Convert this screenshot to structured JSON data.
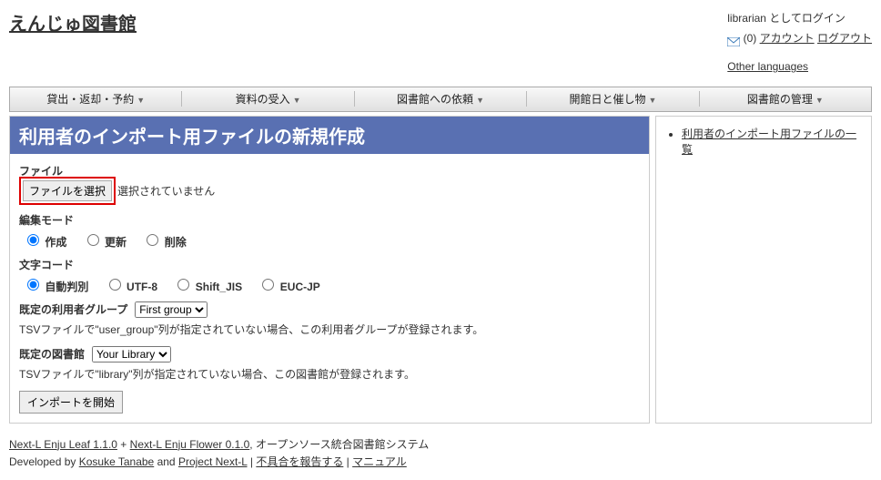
{
  "header": {
    "site_title": "えんじゅ図書館",
    "login_as": "librarian としてログイン",
    "msg_count": "(0)",
    "account_link": "アカウント",
    "logout_link": "ログアウト",
    "other_lang": "Other languages"
  },
  "nav": {
    "items": [
      "貸出・返却・予約",
      "資料の受入",
      "図書館への依頼",
      "開館日と催し物",
      "図書館の管理"
    ]
  },
  "page": {
    "title": "利用者のインポート用ファイルの新規作成",
    "file_label": "ファイル",
    "file_button": "ファイルを選択",
    "file_status": "選択されていません",
    "edit_mode_label": "編集モード",
    "edit_modes": {
      "create": "作成",
      "update": "更新",
      "delete": "削除"
    },
    "encoding_label": "文字コード",
    "encodings": {
      "auto": "自動判別",
      "utf8": "UTF-8",
      "sjis": "Shift_JIS",
      "eucjp": "EUC-JP"
    },
    "group_label": "既定の利用者グループ",
    "group_option": "First group",
    "group_hint": "TSVファイルで\"user_group\"列が指定されていない場合、この利用者グループが登録されます。",
    "library_label": "既定の図書館",
    "library_option": "Your Library",
    "library_hint": "TSVファイルで\"library\"列が指定されていない場合、この図書館が登録されます。",
    "submit": "インポートを開始"
  },
  "sidebar": {
    "list_link": "利用者のインポート用ファイルの一覧"
  },
  "footer": {
    "leaf": "Next-L Enju Leaf 1.1.0",
    "plus": " + ",
    "flower": "Next-L Enju Flower 0.1.0",
    "tagline": ", オープンソース統合図書館システム",
    "dev_prefix": "Developed by ",
    "dev1": "Kosuke Tanabe",
    "and": " and ",
    "dev2": "Project Next-L",
    "sep": " | ",
    "report": "不具合を報告する",
    "manual": "マニュアル"
  }
}
